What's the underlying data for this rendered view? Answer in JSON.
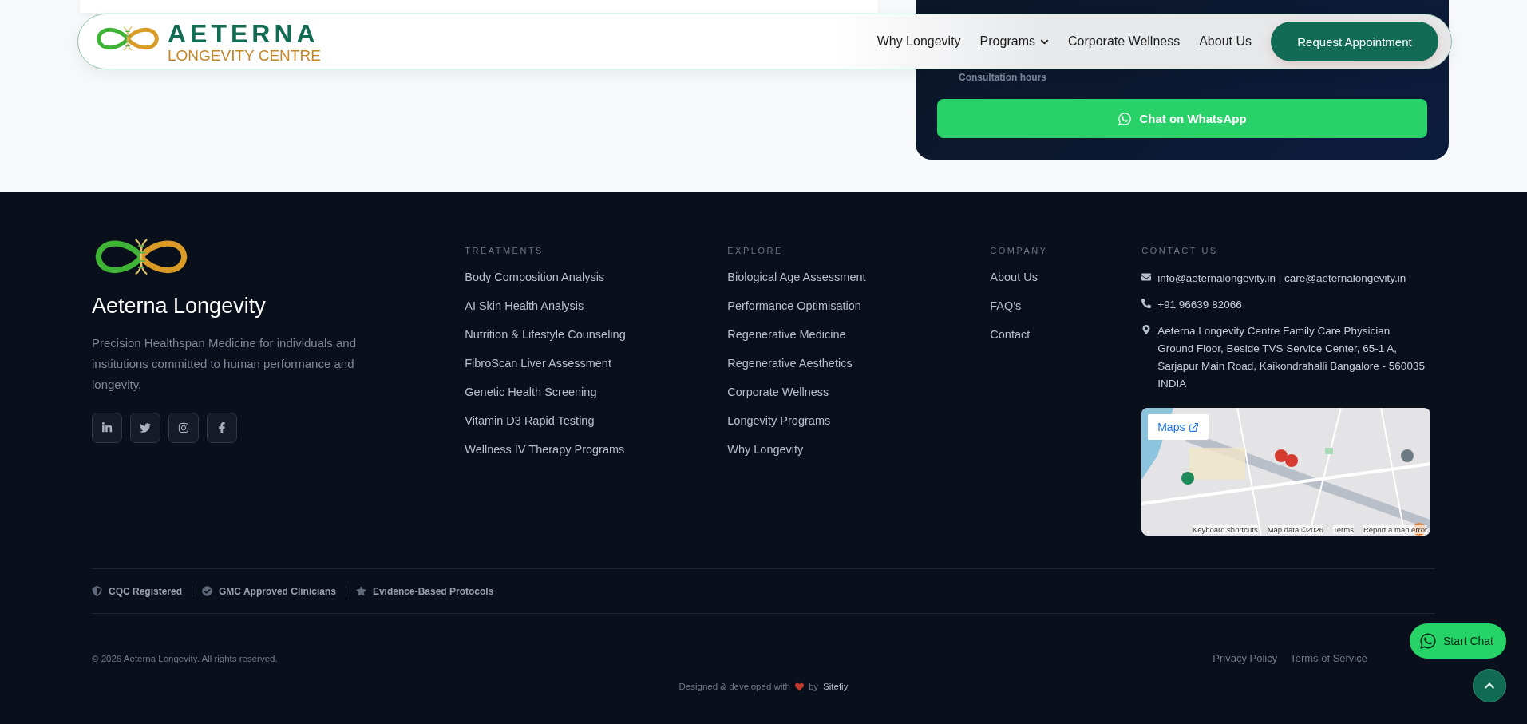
{
  "top_section": {
    "consultation_note": "Consultation hours",
    "whatsapp_button": "Chat on WhatsApp"
  },
  "navbar": {
    "brand_title": "AETERNA",
    "brand_subtitle": "LONGEVITY CENTRE",
    "links": [
      {
        "label": "Why Longevity",
        "kind": "link"
      },
      {
        "label": "Programs",
        "kind": "dropdown"
      },
      {
        "label": "Corporate Wellness",
        "kind": "link"
      },
      {
        "label": "About Us",
        "kind": "link"
      }
    ],
    "cta": "Request Appointment"
  },
  "footer": {
    "brand": {
      "name": "Aeterna Longevity",
      "description": "Precision Healthspan Medicine for individuals and institutions committed to human performance and longevity."
    },
    "socials": [
      {
        "kind": "linkedin"
      },
      {
        "kind": "twitter"
      },
      {
        "kind": "instagram"
      },
      {
        "kind": "facebook"
      }
    ],
    "columns": [
      {
        "heading": "TREATMENTS",
        "items": [
          "Body Composition Analysis",
          "AI Skin Health Analysis",
          "Nutrition & Lifestyle Counseling",
          "FibroScan Liver Assessment",
          "Genetic Health Screening",
          "Vitamin D3 Rapid Testing",
          "Wellness IV Therapy Programs"
        ]
      },
      {
        "heading": "EXPLORE",
        "items": [
          "Biological Age Assessment",
          "Performance Optimisation",
          "Regenerative Medicine",
          "Regenerative Aesthetics",
          "Corporate Wellness",
          "Longevity Programs",
          "Why Longevity"
        ]
      },
      {
        "heading": "COMPANY",
        "items": [
          "About Us",
          "FAQ's",
          "Contact"
        ]
      }
    ],
    "contact": {
      "heading": "CONTACT US",
      "items": [
        {
          "kind": "email",
          "lines": [
            "info@aeternalongevity.in | care@aeternalongevity.in"
          ]
        },
        {
          "kind": "phone",
          "lines": [
            "+91 96639 82066"
          ]
        },
        {
          "kind": "address",
          "lines": [
            "Aeterna Longevity Centre Family Care Physician",
            "Ground Floor, Beside TVS Service Center, 65-1 A,",
            "Sarjapur Main Road, Kaikondrahalli Bangalore - 560035",
            "INDIA"
          ]
        }
      ]
    },
    "map": {
      "kind": "picture",
      "button": "Maps",
      "attribution": [
        "Keyboard shortcuts",
        "Map data ©2026",
        "Terms",
        "Report a map error"
      ]
    },
    "badges": [
      {
        "kind": "shield",
        "label": "CQC Registered"
      },
      {
        "kind": "check",
        "label": "GMC Approved Clinicians"
      },
      {
        "kind": "star",
        "label": "Evidence-Based Protocols"
      }
    ],
    "copyright": "© 2026 Aeterna Longevity. All rights reserved.",
    "legal_links": [
      "Privacy Policy",
      "Terms of Service"
    ],
    "credit": {
      "text": "Designed & developed with",
      "by": "by",
      "author": "Sitefiy"
    }
  },
  "floating": {
    "chat_button": "Start Chat"
  }
}
